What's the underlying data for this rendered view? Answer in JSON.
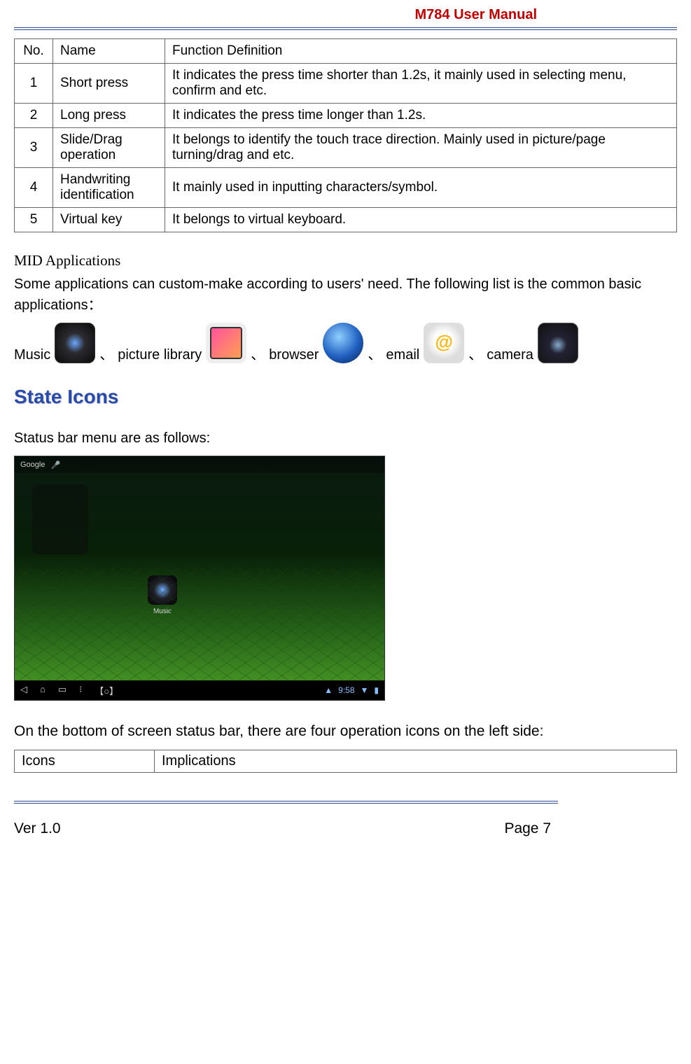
{
  "header": {
    "title": "M784  User  Manual"
  },
  "defTable": {
    "headers": {
      "no": "No.",
      "name": "Name",
      "def": "Function Definition"
    },
    "rows": [
      {
        "no": "1",
        "name": "Short press",
        "def": "It indicates the press time shorter than 1.2s, it mainly used in selecting menu, confirm and etc."
      },
      {
        "no": "2",
        "name": "Long press",
        "def": "It indicates the press time longer than 1.2s."
      },
      {
        "no": "3",
        "name": "Slide/Drag operation",
        "def": "It belongs to identify the touch trace direction. Mainly used in picture/page turning/drag and etc."
      },
      {
        "no": "4",
        "name": "Handwriting identification",
        "def": "It mainly used in inputting characters/symbol."
      },
      {
        "no": "5",
        "name": "Virtual key",
        "def": "It belongs to virtual keyboard."
      }
    ]
  },
  "midApps": {
    "heading": "MID Applications",
    "intro": "Some applications can custom-make according to users' need. The following list is the common basic applications：",
    "items": {
      "music": "Music",
      "gallery": "picture library",
      "browser": "browser",
      "email": "email",
      "camera": "camera"
    },
    "sep": "、"
  },
  "stateIcons": {
    "heading": "State Icons",
    "intro": "Status bar menu are as follows:"
  },
  "screenshot": {
    "topbarGoogle": "Google",
    "musicLabel": "Music",
    "clock": "9:58",
    "navBack": "◁",
    "navHome": "⌂",
    "navRecent": "▭",
    "navExtra": "⁝",
    "navScreenshot": "【○】",
    "wifi": "▲",
    "signal": "▼"
  },
  "bottomNote": "On the bottom of screen status bar, there are four operation icons on the left side:",
  "iconsTable": {
    "h1": "Icons",
    "h2": "Implications"
  },
  "footer": {
    "ver": "Ver 1.0",
    "page": "Page 7"
  }
}
